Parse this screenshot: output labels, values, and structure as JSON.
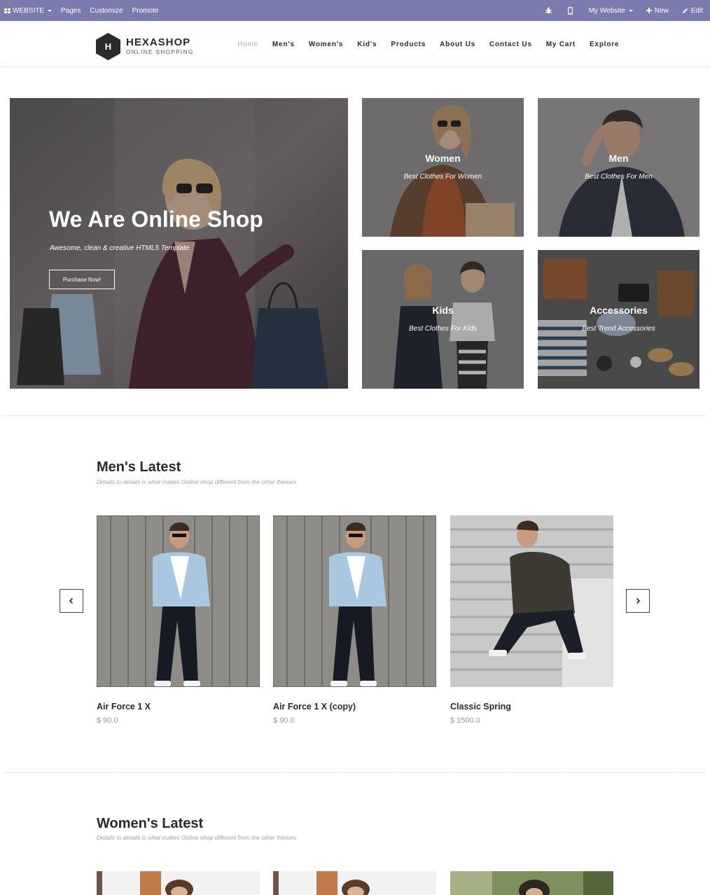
{
  "admin_bar": {
    "website_label": "WEBSITE",
    "pages_label": "Pages",
    "customize_label": "Customize",
    "promote_label": "Promote",
    "site_label": "My Website",
    "new_label": "New",
    "edit_label": "Edit",
    "color": "#7c7bad"
  },
  "brand": {
    "initial": "H",
    "name": "HEXASHOP",
    "tagline": "ONLINE SHOPPING"
  },
  "nav": {
    "items": [
      {
        "label": "Home",
        "active": true
      },
      {
        "label": "Men's"
      },
      {
        "label": "Women's"
      },
      {
        "label": "Kid's"
      },
      {
        "label": "Products"
      },
      {
        "label": "About Us"
      },
      {
        "label": "Contact Us"
      },
      {
        "label": "My Cart"
      },
      {
        "label": "Explore"
      }
    ]
  },
  "hero": {
    "title": "We Are Online Shop",
    "subtitle": "Awesome, clean & creative HTML5 Template",
    "button_label": "Purchase Now!"
  },
  "categories": [
    {
      "title": "Women",
      "subtitle": "Best Clothes For Women"
    },
    {
      "title": "Men",
      "subtitle": "Best Clothes For Men"
    },
    {
      "title": "Kids",
      "subtitle": "Best Clothes For Kids"
    },
    {
      "title": "Accessories",
      "subtitle": "Best Trend Accessories"
    }
  ],
  "mens_latest": {
    "title": "Men's Latest",
    "subtitle": "Details to details is what makes Online shop different from the other themes.",
    "products": [
      {
        "name": "Air Force 1 X",
        "price": "$ 90.0"
      },
      {
        "name": "Air Force 1 X (copy)",
        "price": "$ 90.0"
      },
      {
        "name": "Classic Spring",
        "price": "$ 1500.0"
      }
    ]
  },
  "womens_latest": {
    "title": "Women's Latest",
    "subtitle": "Details to details is what makes Online shop different from the other themes."
  },
  "icons": [
    "apps-grid-icon",
    "bug-icon",
    "mobile-icon",
    "plus-icon",
    "pencil-icon",
    "chevron-left-icon",
    "chevron-right-icon"
  ]
}
